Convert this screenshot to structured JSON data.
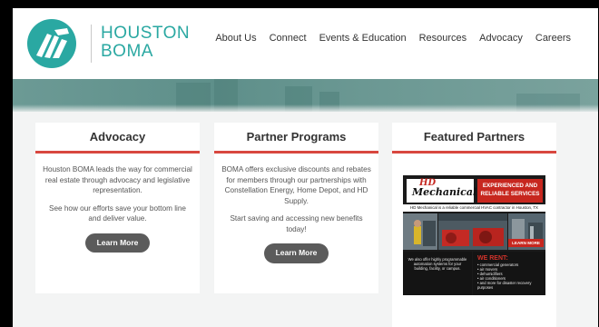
{
  "logo": {
    "line1": "HOUSTON",
    "line2": "BOMA",
    "color": "#2aa8a2"
  },
  "nav": {
    "items": [
      "About Us",
      "Connect",
      "Events & Education",
      "Resources",
      "Advocacy",
      "Careers"
    ]
  },
  "cards": [
    {
      "title": "Advocacy",
      "paragraphs": [
        "Houston BOMA leads the way for commercial real estate through advocacy and legislative representation.",
        "See how our efforts save your bottom line and deliver value."
      ],
      "button": "Learn More"
    },
    {
      "title": "Partner Programs",
      "paragraphs": [
        "BOMA offers exclusive discounts and rebates for members through our partnerships with Constellation Energy, Home Depot, and HD Supply.",
        "Start saving and accessing new benefits today!"
      ],
      "button": "Learn More"
    },
    {
      "title": "Featured Partners"
    }
  ],
  "ad": {
    "brand_hd": "HD",
    "brand_name": "Mechanical",
    "headline": "EXPERIENCED AND RELIABLE SERVICES",
    "strip": "HD Mechanical is a reliable commercial HVAC contractor in Houston, TX",
    "left_text": "We also offer highly programmable automation systems for your building, facility, or campus.",
    "we_rent": "WE RENT:",
    "rent_items": [
      "• commercial generators",
      "• air movers",
      "• dehumidifiers",
      "• air conditioners",
      "• and more for disaster recovery purposes"
    ],
    "learn_more": "LEARN MORE"
  },
  "colors": {
    "accent_red": "#d8473f",
    "button_gray": "#5b5b5b",
    "banner_teal": "#6c9a95"
  }
}
